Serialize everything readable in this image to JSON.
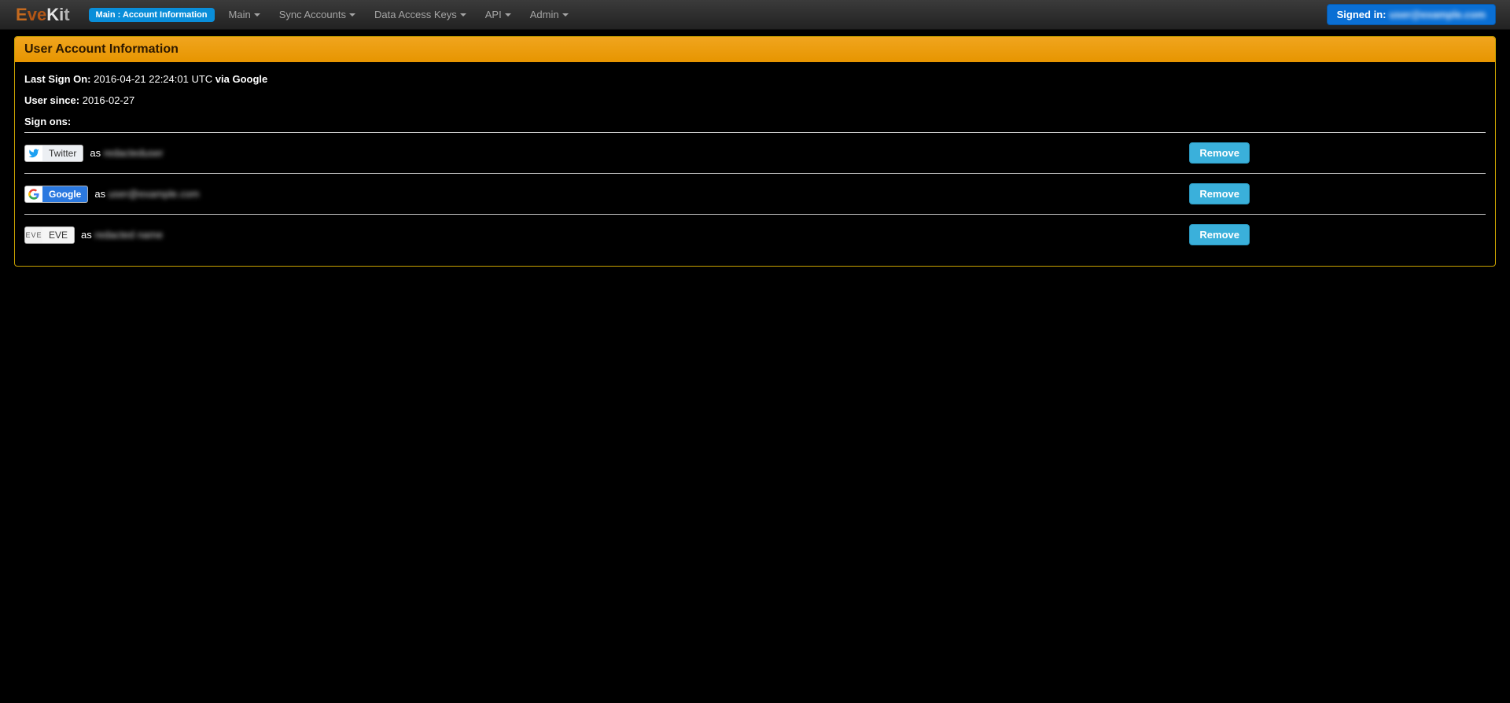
{
  "brand": {
    "text": "EveKit"
  },
  "nav": {
    "active_label": "Main : Account Information",
    "items": [
      {
        "label": "Main",
        "dropdown": true
      },
      {
        "label": "Sync Accounts",
        "dropdown": true
      },
      {
        "label": "Data Access Keys",
        "dropdown": true
      },
      {
        "label": "API",
        "dropdown": true
      },
      {
        "label": "Admin",
        "dropdown": true
      }
    ],
    "signed_in_prefix": "Signed in:",
    "signed_in_user": "user@example.com"
  },
  "panel": {
    "title": "User Account Information",
    "last_sign_on_label": "Last Sign On:",
    "last_sign_on_value": "2016-04-21 22:24:01 UTC",
    "last_sign_on_via": "via Google",
    "user_since_label": "User since:",
    "user_since_value": "2016-02-27",
    "sign_ons_label": "Sign ons:",
    "as_text": "as",
    "remove_label": "Remove",
    "signons": [
      {
        "provider": "Twitter",
        "provider_key": "twitter",
        "username": "redacteduser"
      },
      {
        "provider": "Google",
        "provider_key": "google",
        "username": "user@example.com"
      },
      {
        "provider": "EVE",
        "provider_key": "eve",
        "username": "redacted name"
      }
    ]
  }
}
